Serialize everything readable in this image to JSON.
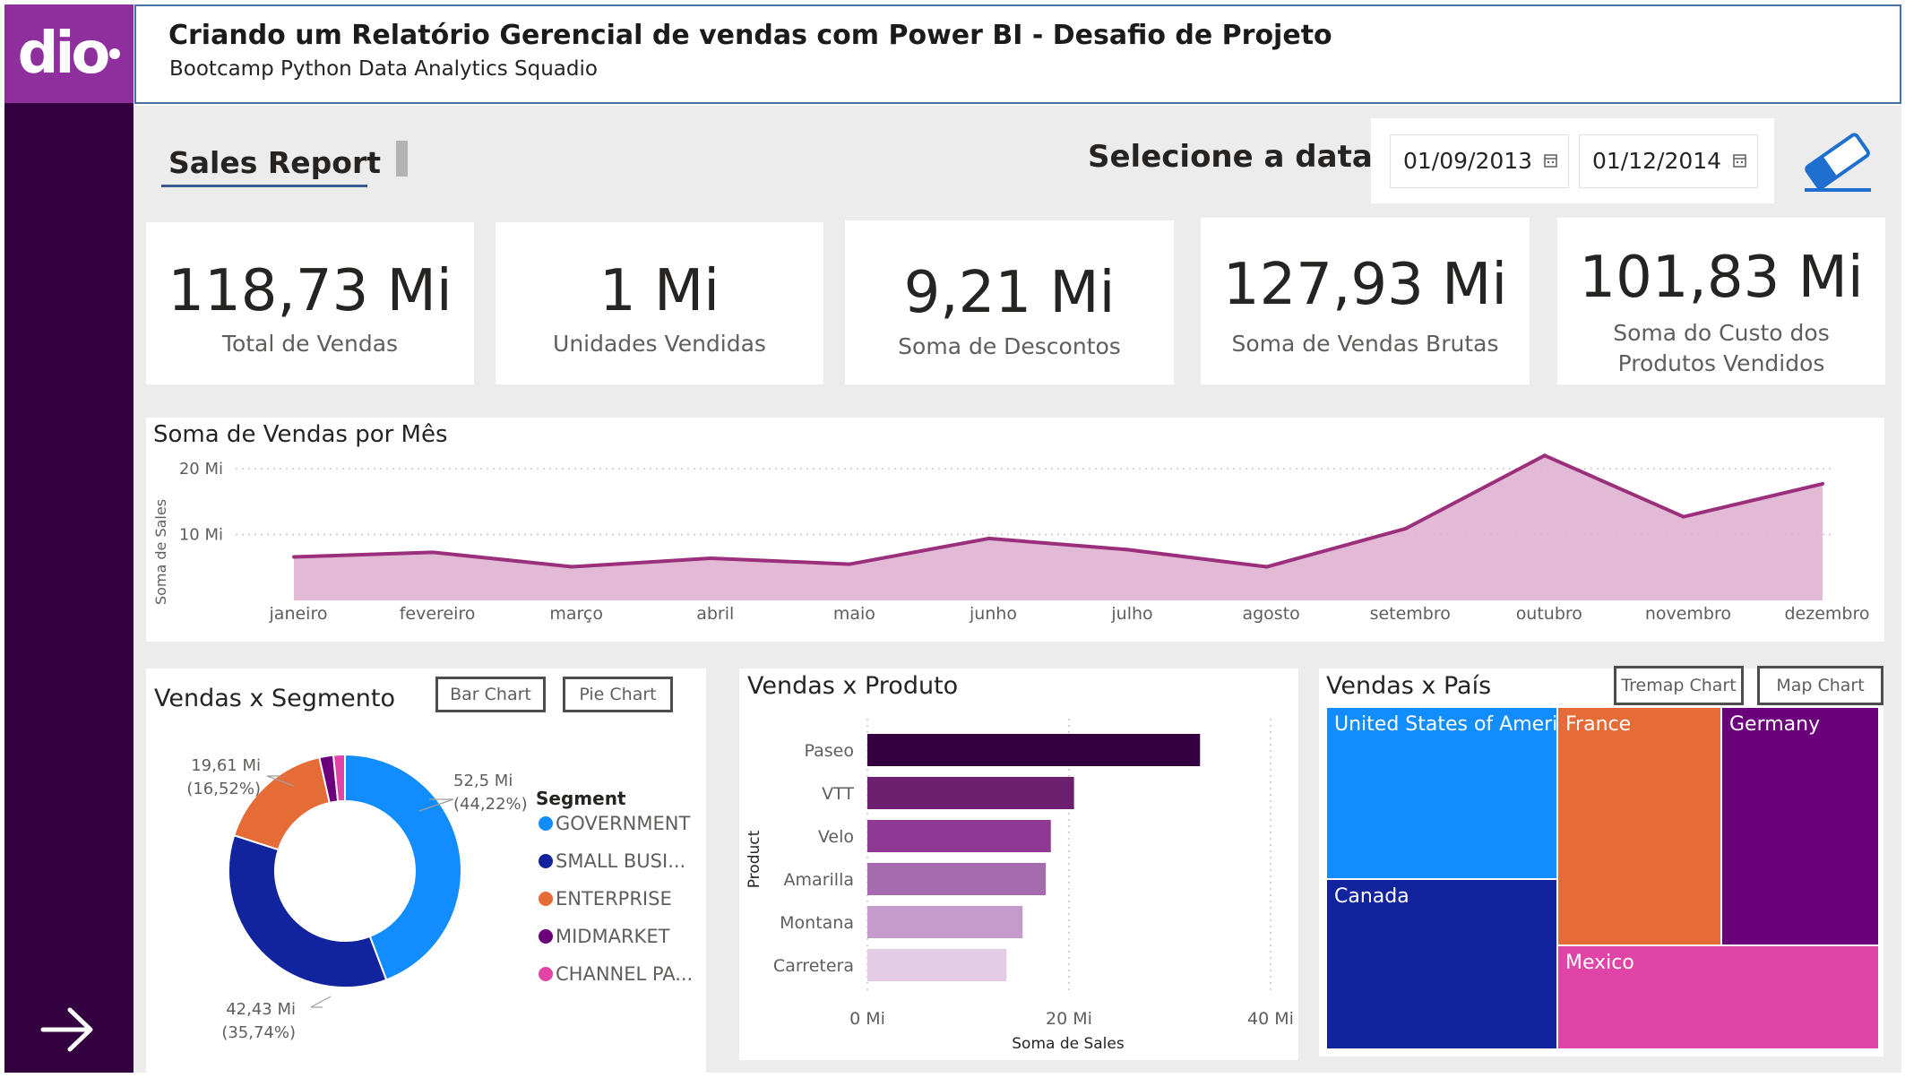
{
  "header": {
    "title": "Criando um Relatório Gerencial de vendas com Power BI - Desafio de Projeto",
    "subtitle": "Bootcamp Python Data Analytics Squadio",
    "logo_text": "dio"
  },
  "colors": {
    "rail": "#330040",
    "logo_bg": "#8e2f9d",
    "line": "#9b2f7c",
    "area": "#dfb3d2"
  },
  "report": {
    "title": "Sales Report",
    "date_label": "Selecione a data:",
    "date_start": "01/09/2013",
    "date_end": "01/12/2014",
    "calendar_icon": "calendar-icon",
    "clear_icon": "eraser-icon",
    "nav_icon": "arrow-right-icon"
  },
  "kpis": [
    {
      "value": "118,73 Mi",
      "label": "Total de Vendas"
    },
    {
      "value": "1 Mi",
      "label": "Unidades Vendidas"
    },
    {
      "value": "9,21 Mi",
      "label": "Soma de Descontos"
    },
    {
      "value": "127,93 Mi",
      "label": "Soma de Vendas Brutas"
    },
    {
      "value": "101,83 Mi",
      "label_line1": "Soma do Custo dos",
      "label_line2": "Produtos Vendidos"
    }
  ],
  "buttons": {
    "bar_chart": "Bar Chart",
    "pie_chart": "Pie Chart",
    "treemap_chart": "Tremap Chart",
    "map_chart": "Map Chart"
  },
  "chart_data": [
    {
      "type": "area",
      "title": "Soma de Vendas por Mês",
      "ylabel": "Soma de Sales",
      "y_ticks": [
        "10 Mi",
        "20 Mi"
      ],
      "y_tick_values": [
        10,
        20
      ],
      "ylim": [
        0,
        25
      ],
      "grid": true,
      "categories": [
        "janeiro",
        "fevereiro",
        "março",
        "abril",
        "maio",
        "junho",
        "julho",
        "agosto",
        "setembro",
        "outubro",
        "novembro",
        "dezembro"
      ],
      "values": [
        6.6,
        7.3,
        5.1,
        6.4,
        5.5,
        9.4,
        7.7,
        5.1,
        10.9,
        22.0,
        12.7,
        17.7
      ]
    },
    {
      "type": "pie",
      "title": "Vendas x Segmento",
      "legend_title": "Segment",
      "legend_position": "right",
      "slices": [
        {
          "name": "GOVERNMENT",
          "value": 52.5,
          "label": "52,5 Mi",
          "pct": "(44,22%)",
          "color": "#118dff"
        },
        {
          "name": "SMALL BUSI...",
          "value": 42.43,
          "label": "42,43 Mi",
          "pct": "(35,74%)",
          "color": "#12239e"
        },
        {
          "name": "ENTERPRISE",
          "value": 19.61,
          "label": "19,61 Mi",
          "pct": "(16,52%)",
          "color": "#e66c37"
        },
        {
          "name": "MIDMARKET",
          "value": 2.3,
          "color": "#6b007b"
        },
        {
          "name": "CHANNEL PA...",
          "value": 1.9,
          "color": "#e044a7"
        }
      ]
    },
    {
      "type": "bar",
      "orientation": "horizontal",
      "title": "Vendas x Produto",
      "xlabel": "Soma de Sales",
      "ylabel": "Product",
      "x_ticks": [
        "0 Mi",
        "20 Mi",
        "40 Mi"
      ],
      "xlim": [
        0,
        40
      ],
      "categories": [
        "Paseo",
        "VTT",
        "Velo",
        "Amarilla",
        "Montana",
        "Carretera"
      ],
      "values": [
        33.0,
        20.5,
        18.2,
        17.7,
        15.4,
        13.8
      ],
      "colors": [
        "#330040",
        "#6b1f6e",
        "#8e3a94",
        "#a66aae",
        "#c49bcb",
        "#e4cce6"
      ]
    },
    {
      "type": "treemap",
      "title": "Vendas x País",
      "items": [
        {
          "name": "United States of America",
          "color": "#118dff"
        },
        {
          "name": "Canada",
          "color": "#12239e"
        },
        {
          "name": "France",
          "color": "#e66c37"
        },
        {
          "name": "Germany",
          "color": "#6b007b"
        },
        {
          "name": "Mexico",
          "color": "#e044a7"
        }
      ]
    }
  ]
}
